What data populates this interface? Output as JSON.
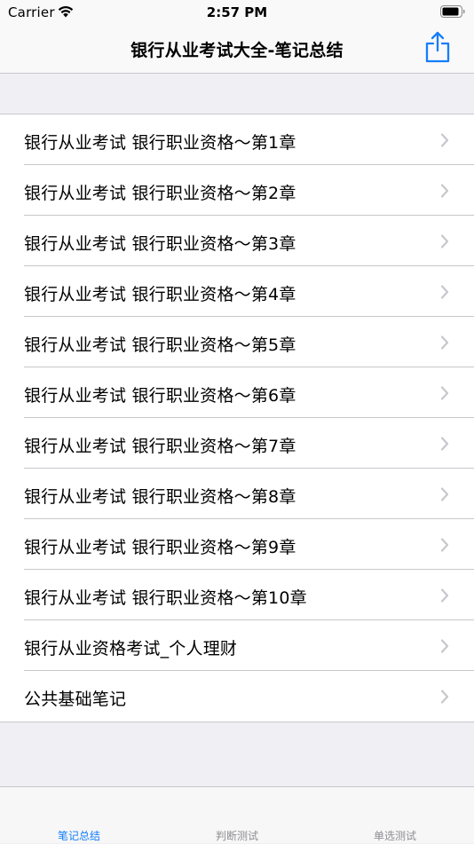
{
  "status_bar": {
    "carrier": "Carrier",
    "time": "2:57 PM"
  },
  "nav": {
    "title": "银行从业考试大全-笔记总结"
  },
  "list": {
    "items": [
      "银行从业考试 银行职业资格～第1章",
      "银行从业考试 银行职业资格～第2章",
      "银行从业考试 银行职业资格～第3章",
      "银行从业考试 银行职业资格～第4章",
      "银行从业考试 银行职业资格～第5章",
      "银行从业考试 银行职业资格～第6章",
      "银行从业考试 银行职业资格～第7章",
      "银行从业考试 银行职业资格～第8章",
      "银行从业考试 银行职业资格～第9章",
      "银行从业考试 银行职业资格～第10章",
      "银行从业资格考试_个人理财",
      "公共基础笔记"
    ]
  },
  "tab_bar": {
    "tabs": [
      {
        "label": "笔记总结",
        "selected": true
      },
      {
        "label": "判断测试",
        "selected": false
      },
      {
        "label": "单选测试",
        "selected": false
      }
    ]
  },
  "colors": {
    "accent": "#147efb",
    "inactive_tab": "#8e8e93",
    "separator": "#c8c7cc",
    "chevron": "#c7c7cc",
    "background": "#efeff4"
  }
}
